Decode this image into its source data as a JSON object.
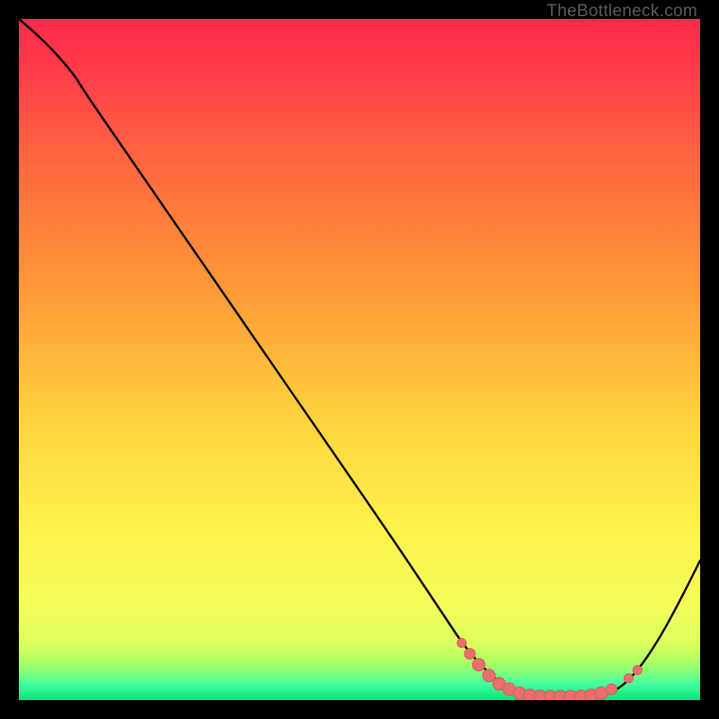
{
  "attribution": "TheBottleneck.com",
  "colors": {
    "bg": "#000000",
    "curve": "#000000",
    "marker_fill": "#ee6d6d",
    "marker_stroke": "#d45b5b",
    "grad_top": "#ff2a4b",
    "grad_mid1": "#ff8a3a",
    "grad_mid2": "#ffe24a",
    "grad_low": "#f7ff66",
    "grad_green1": "#9dff66",
    "grad_green2": "#2bff98",
    "grad_bottom": "#00e47c"
  },
  "chart_data": {
    "type": "line",
    "title": "",
    "xlabel": "",
    "ylabel": "",
    "xlim": [
      0,
      100
    ],
    "ylim": [
      0,
      100
    ],
    "curve": [
      {
        "x": 0.0,
        "y": 100.0
      },
      {
        "x": 4.0,
        "y": 96.5
      },
      {
        "x": 8.0,
        "y": 92.0
      },
      {
        "x": 9.5,
        "y": 89.5
      },
      {
        "x": 15.0,
        "y": 81.5
      },
      {
        "x": 25.0,
        "y": 67.0
      },
      {
        "x": 35.0,
        "y": 52.5
      },
      {
        "x": 45.0,
        "y": 38.0
      },
      {
        "x": 55.0,
        "y": 23.5
      },
      {
        "x": 62.0,
        "y": 13.0
      },
      {
        "x": 66.0,
        "y": 7.0
      },
      {
        "x": 70.5,
        "y": 2.5
      },
      {
        "x": 74.0,
        "y": 0.8
      },
      {
        "x": 78.0,
        "y": 0.5
      },
      {
        "x": 82.0,
        "y": 0.5
      },
      {
        "x": 85.0,
        "y": 0.6
      },
      {
        "x": 88.0,
        "y": 1.5
      },
      {
        "x": 91.0,
        "y": 4.5
      },
      {
        "x": 94.0,
        "y": 9.0
      },
      {
        "x": 97.0,
        "y": 14.5
      },
      {
        "x": 100.0,
        "y": 20.5
      }
    ],
    "markers": [
      {
        "x": 65.0,
        "y": 8.4,
        "r": 5
      },
      {
        "x": 66.2,
        "y": 6.8,
        "r": 6
      },
      {
        "x": 67.5,
        "y": 5.2,
        "r": 7
      },
      {
        "x": 69.0,
        "y": 3.6,
        "r": 7
      },
      {
        "x": 70.5,
        "y": 2.4,
        "r": 7
      },
      {
        "x": 72.0,
        "y": 1.6,
        "r": 7
      },
      {
        "x": 73.5,
        "y": 1.0,
        "r": 7
      },
      {
        "x": 75.0,
        "y": 0.7,
        "r": 7
      },
      {
        "x": 76.5,
        "y": 0.55,
        "r": 7
      },
      {
        "x": 78.0,
        "y": 0.5,
        "r": 7
      },
      {
        "x": 79.5,
        "y": 0.5,
        "r": 7
      },
      {
        "x": 81.0,
        "y": 0.5,
        "r": 7
      },
      {
        "x": 82.5,
        "y": 0.55,
        "r": 7
      },
      {
        "x": 84.0,
        "y": 0.7,
        "r": 7
      },
      {
        "x": 85.5,
        "y": 1.0,
        "r": 7
      },
      {
        "x": 87.0,
        "y": 1.6,
        "r": 6
      },
      {
        "x": 89.5,
        "y": 3.2,
        "r": 5
      },
      {
        "x": 90.8,
        "y": 4.4,
        "r": 5
      }
    ]
  }
}
